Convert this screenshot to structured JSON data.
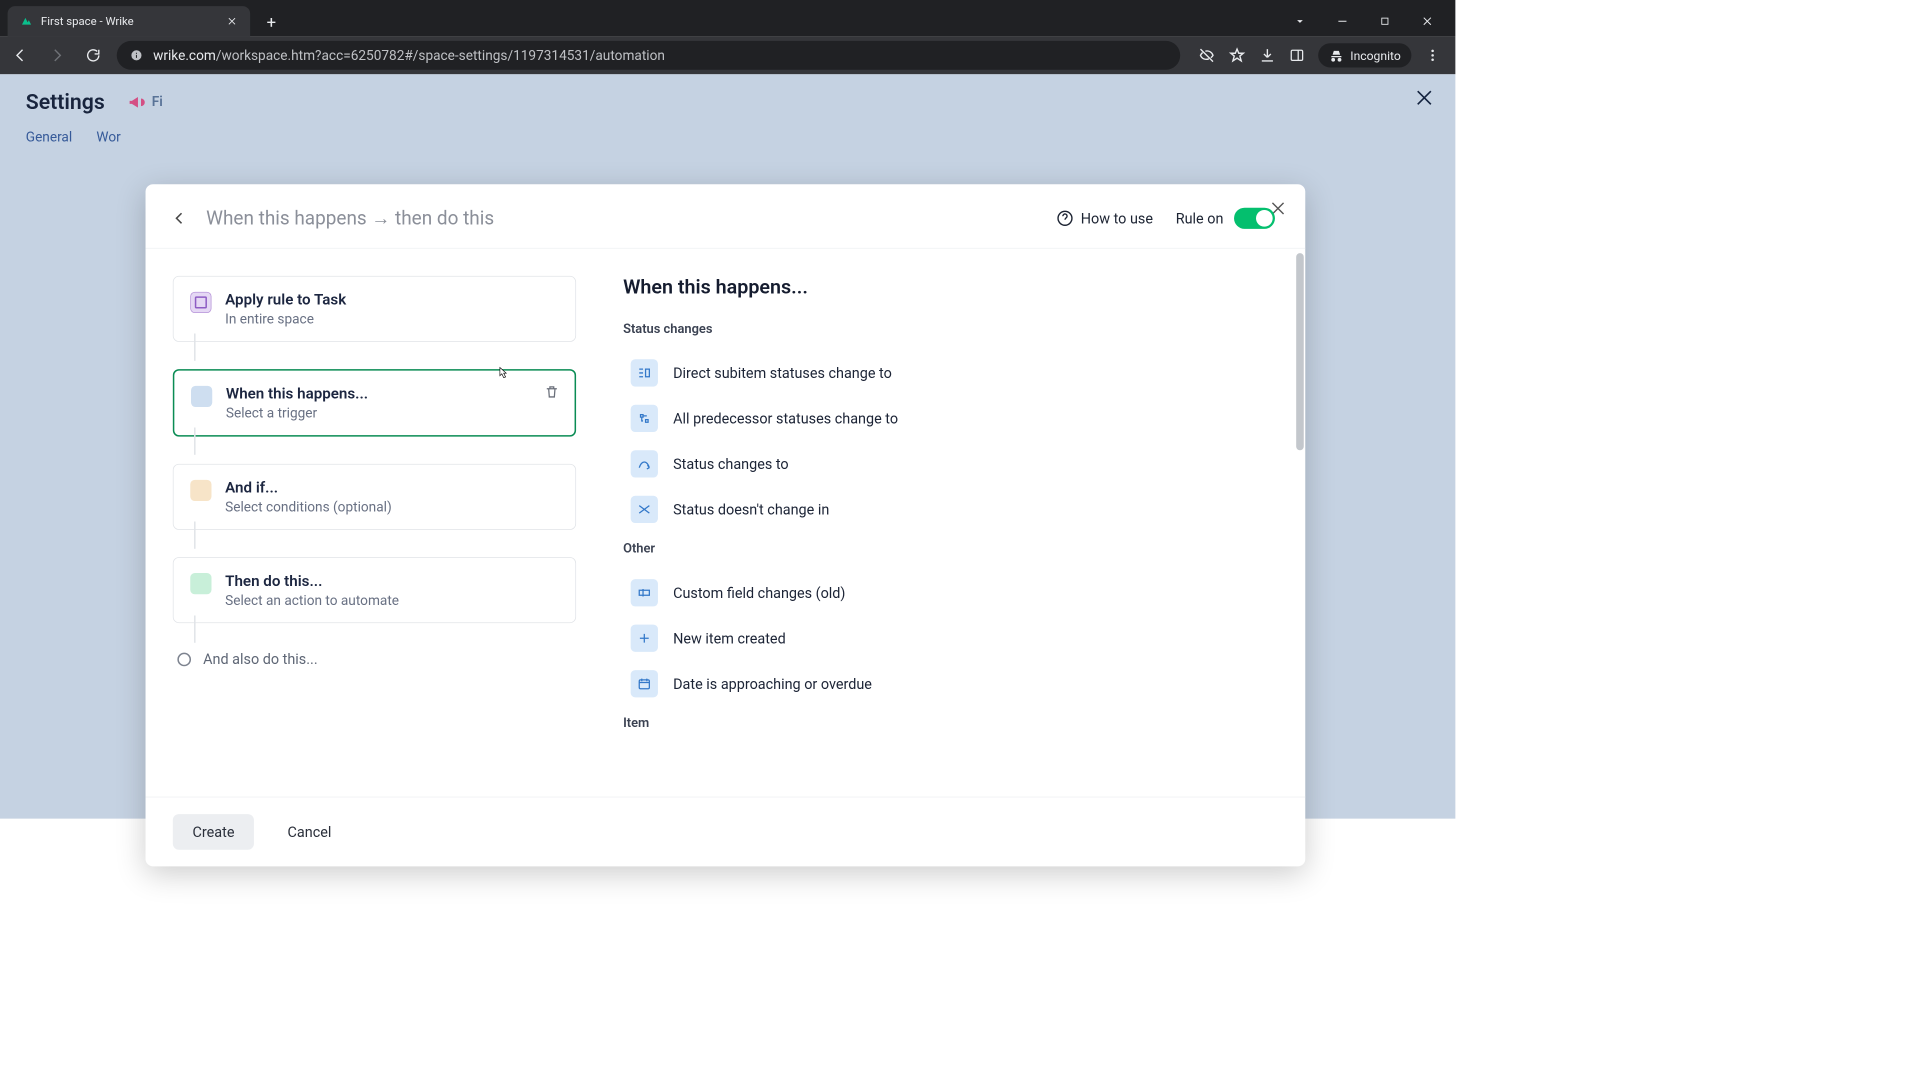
{
  "browser": {
    "tab_title": "First space - Wrike",
    "url_domain": "wrike.com",
    "url_path": "/workspace.htm?acc=6250782#/space-settings/1197314531/automation",
    "incognito_label": "Incognito"
  },
  "page": {
    "settings_title": "Settings",
    "tabs": [
      "General",
      "Wor"
    ]
  },
  "modal": {
    "title": "When this happens → then do this",
    "how_to_use": "How to use",
    "rule_on_label": "Rule on",
    "steps": {
      "apply": {
        "title": "Apply rule to Task",
        "sub": "In entire space"
      },
      "when": {
        "title": "When this happens...",
        "sub": "Select a trigger"
      },
      "andif": {
        "title": "And if...",
        "sub": "Select conditions (optional)"
      },
      "then": {
        "title": "Then do this...",
        "sub": "Select an action to automate"
      },
      "also": "And also do this..."
    },
    "right": {
      "title": "When this happens...",
      "groups": [
        {
          "label": "Status changes",
          "items": [
            "Direct subitem statuses change to",
            "All predecessor statuses change to",
            "Status changes to",
            "Status doesn't change in"
          ]
        },
        {
          "label": "Other",
          "items": [
            "Custom field changes (old)",
            "New item created",
            "Date is approaching or overdue"
          ]
        },
        {
          "label": "Item",
          "items": []
        }
      ]
    },
    "footer": {
      "create": "Create",
      "cancel": "Cancel"
    }
  }
}
